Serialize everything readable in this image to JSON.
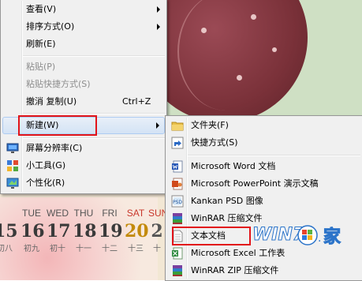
{
  "main_menu": {
    "items": [
      {
        "label": "查看(V)",
        "submenu": true
      },
      {
        "label": "排序方式(O)",
        "submenu": true
      },
      {
        "label": "刷新(E)"
      },
      {
        "label": "粘贴(P)",
        "disabled": true
      },
      {
        "label": "粘贴快捷方式(S)",
        "disabled": true
      },
      {
        "label": "撤消 复制(U)",
        "accelerator": "Ctrl+Z"
      },
      {
        "label": "新建(W)",
        "submenu": true,
        "highlighted": true
      },
      {
        "label": "屏幕分辨率(C)",
        "icon": "display-icon"
      },
      {
        "label": "小工具(G)",
        "icon": "gadgets-icon"
      },
      {
        "label": "个性化(R)",
        "icon": "personalize-icon"
      }
    ]
  },
  "new_submenu": {
    "items": [
      {
        "label": "文件夹(F)",
        "icon": "folder-icon"
      },
      {
        "label": "快捷方式(S)",
        "icon": "shortcut-icon"
      },
      {
        "label": "Microsoft Word 文档",
        "icon": "word-doc-icon"
      },
      {
        "label": "Microsoft PowerPoint 演示文稿",
        "icon": "powerpoint-icon"
      },
      {
        "label": "Kankan PSD 图像",
        "icon": "psd-image-icon"
      },
      {
        "label": "WinRAR 压缩文件",
        "icon": "winrar-icon"
      },
      {
        "label": "文本文档",
        "icon": "text-document-icon"
      },
      {
        "label": "Microsoft Excel 工作表",
        "icon": "excel-icon"
      },
      {
        "label": "WinRAR ZIP 压缩文件",
        "icon": "winrar-zip-icon"
      }
    ]
  },
  "calendar": {
    "days": [
      {
        "weekday": "",
        "day": "15",
        "lunar": "初八"
      },
      {
        "weekday": "TUE",
        "day": "16",
        "lunar": "初九"
      },
      {
        "weekday": "WED",
        "day": "17",
        "lunar": "初十"
      },
      {
        "weekday": "THU",
        "day": "18",
        "lunar": "十一"
      },
      {
        "weekday": "FRI",
        "day": "19",
        "lunar": "十二"
      },
      {
        "weekday": "SAT",
        "day": "20",
        "lunar": "十三"
      },
      {
        "weekday": "SUN",
        "day": "2",
        "lunar": "十"
      }
    ]
  },
  "watermark": {
    "text_win": "WIN7",
    "text_dot": ".",
    "text_home": "家"
  },
  "colors": {
    "highlight_border": "#e2141a",
    "menu_bg": "#f0f0f0",
    "selection": "#d4e3f5"
  }
}
